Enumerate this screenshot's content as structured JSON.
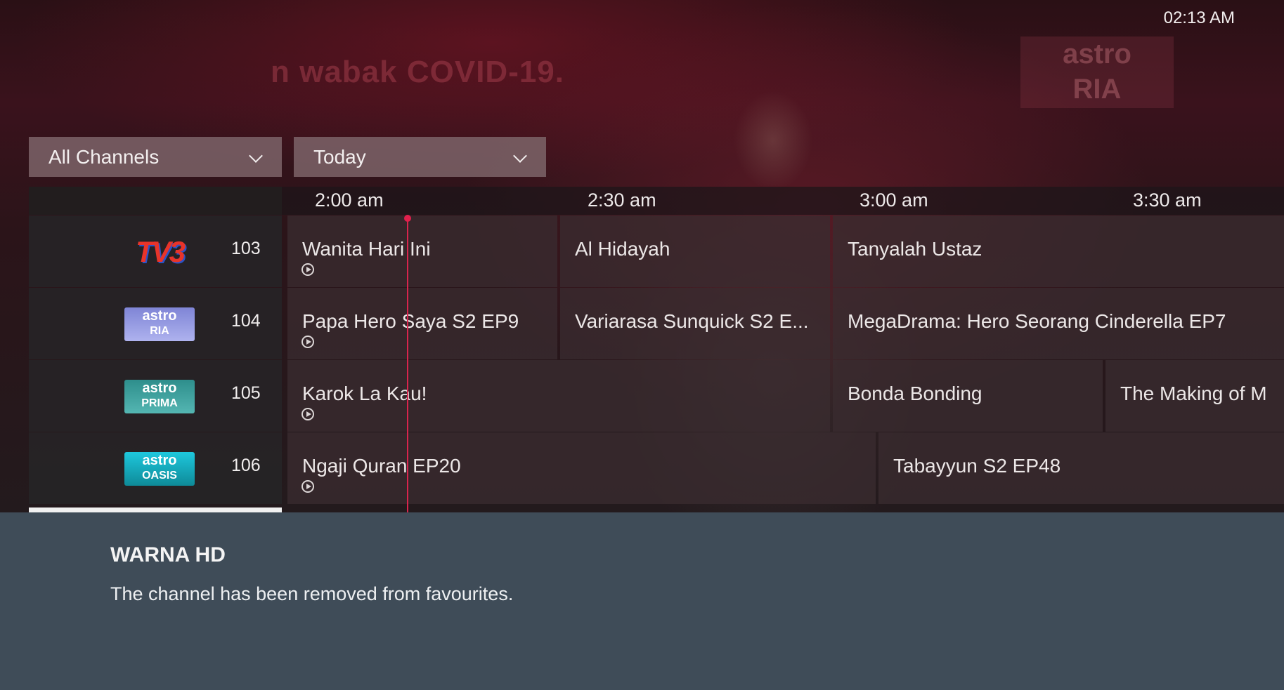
{
  "status_bar": {
    "clock": "02:13 AM"
  },
  "background": {
    "ticker_text": "n wabak COVID-19.",
    "watermark_line1": "astro",
    "watermark_line2": "RIA"
  },
  "filters": {
    "channel_filter": "All Channels",
    "day_filter": "Today"
  },
  "timeline": [
    "2:00 am",
    "2:30 am",
    "3:00 am",
    "3:30 am"
  ],
  "channels": [
    {
      "number": "103",
      "logo_text": "TV3",
      "logo_line1": "",
      "logo_line2": "",
      "programs": [
        {
          "title": "Wanita Hari Ini",
          "replay": true
        },
        {
          "title": "Al Hidayah",
          "replay": false
        },
        {
          "title": "Tanyalah Ustaz",
          "replay": false
        }
      ]
    },
    {
      "number": "104",
      "logo_line1": "astro",
      "logo_line2": "RIA",
      "programs": [
        {
          "title": "Papa Hero Saya S2 EP9",
          "replay": true
        },
        {
          "title": "Variarasa Sunquick S2 E...",
          "replay": false
        },
        {
          "title": "MegaDrama: Hero Seorang Cinderella EP7",
          "replay": false
        }
      ]
    },
    {
      "number": "105",
      "logo_line1": "astro",
      "logo_line2": "PRIMA",
      "programs": [
        {
          "title": "Karok La Kau!",
          "replay": true
        },
        {
          "title": "Bonda Bonding",
          "replay": false
        },
        {
          "title": "The Making of M",
          "replay": false
        }
      ]
    },
    {
      "number": "106",
      "logo_line1": "astro",
      "logo_line2": "OASIS",
      "programs": [
        {
          "title": "Ngaji Quran EP20",
          "replay": true
        },
        {
          "title": "Tabayyun S2 EP48",
          "replay": false
        }
      ]
    }
  ],
  "toast": {
    "title": "WARNA HD",
    "message": "The channel has been removed from favourites."
  },
  "colors": {
    "now_line": "#d9244d",
    "toast_bg": "#3f4c58",
    "dropdown_bg": "#7d6468"
  },
  "icons": [
    "chevron-down-icon",
    "replay-icon",
    "current-time-indicator"
  ]
}
